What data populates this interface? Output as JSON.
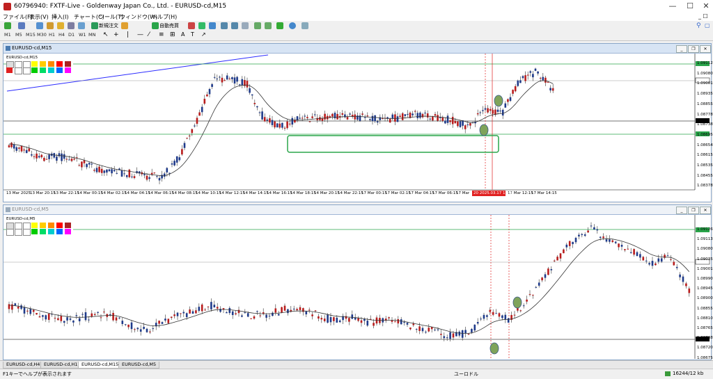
{
  "window": {
    "title": "60796940: FXTF-Live - Goldenway Japan Co., Ltd. - EURUSD-cd,M15",
    "controls": [
      "—",
      "☐",
      "✕"
    ]
  },
  "menu": [
    "ファイル(F)",
    "表示(V)",
    "挿入(I)",
    "チャート(C)",
    "ツール(T)",
    "ウィンドウ(W)",
    "ヘルプ(H)"
  ],
  "toolbar": {
    "new_order": "新規注文",
    "auto_trading": "自動売買",
    "timeframes": [
      "M1",
      "M5",
      "M15",
      "M30",
      "H1",
      "H4",
      "D1",
      "W1",
      "MN"
    ]
  },
  "chart_top": {
    "title": "EURUSD-cd,M15",
    "symbol_label": "EURUSD-cd,M15",
    "price_labels": [
      "1.09112",
      "1.09080",
      "1.09001",
      "1.08935",
      "1.08855",
      "1.08778",
      "1.08738",
      "1.08695",
      "1.08654",
      "1.08615",
      "1.08535",
      "1.08455",
      "1.08378"
    ],
    "time_labels": [
      "13 Mar 2025",
      "13 Mar 20:15",
      "13 Mar 22:15",
      "14 Mar 00:15",
      "14 Mar 02:15",
      "14 Mar 04:15",
      "14 Mar 06:15",
      "14 Mar 08:15",
      "14 Mar 10:15",
      "14 Mar 12:15",
      "14 Mar 14:15",
      "14 Mar 16:15",
      "14 Mar 18:15",
      "14 Mar 20:15",
      "14 Mar 22:15",
      "17 Mar 00:15",
      "17 Mar 02:15",
      "17 Mar 04:15",
      "17 Mar 06:15",
      "17 Mar",
      "17 Mar 12:15",
      "17 Mar 14:15"
    ],
    "cursor_time": "20 2025.03.17 11:00"
  },
  "chart_bottom": {
    "title": "EURUSD-cd,M5",
    "symbol_label": "EURUSD-cd,M5",
    "price_labels": [
      "1.09126",
      "1.09113",
      "1.09080",
      "1.09035",
      "1.09001",
      "1.08990",
      "1.08945",
      "1.08900",
      "1.08855",
      "1.08810",
      "1.08765",
      "1.08738",
      "1.08720",
      "1.08675"
    ]
  },
  "tabs": [
    "EURUSD-cd,H4",
    "EURUSD-cd,H1",
    "EURUSD-cd,M15",
    "EURUSD-cd,M5"
  ],
  "active_tab": "EURUSD-cd,M15",
  "status": {
    "help": "F1キーでヘルプが表示されます",
    "profile": "ユーロドル",
    "traffic": "16244/12 kb"
  },
  "colors": {
    "bull": "#1e3a8a",
    "bear": "#b91c1c",
    "marker": "#7fa35a",
    "zone": "#2aa54a",
    "hline_green": "#2aa54a",
    "trend": "#2a2aff"
  }
}
